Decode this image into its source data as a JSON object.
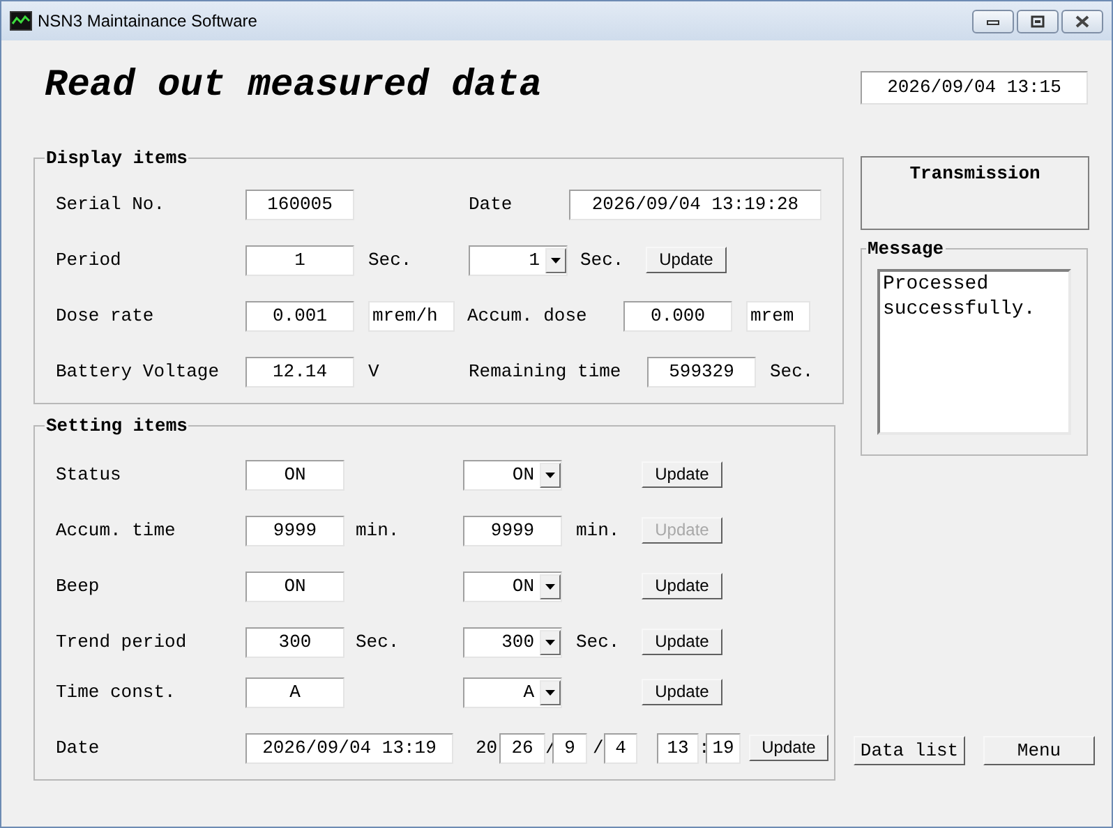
{
  "window": {
    "title": "NSN3 Maintainance Software"
  },
  "heading": "Read out measured data",
  "clock": "2026/09/04 13:15",
  "display_items": {
    "title": "Display items",
    "serial_no": {
      "label": "Serial No.",
      "value": "160005"
    },
    "date": {
      "label": "Date",
      "value": "2026/09/04 13:19:28"
    },
    "period": {
      "label": "Period",
      "value": "1",
      "unit": "Sec.",
      "select": "1",
      "select_unit": "Sec.",
      "button": "Update"
    },
    "dose_rate": {
      "label": "Dose rate",
      "value": "0.001",
      "unit": "mrem/h"
    },
    "accum_dose": {
      "label": "Accum. dose",
      "value": "0.000",
      "unit": "mrem"
    },
    "battery_voltage": {
      "label": "Battery Voltage",
      "value": "12.14",
      "unit": "V"
    },
    "remaining_time": {
      "label": "Remaining time",
      "value": "599329",
      "unit": "Sec."
    }
  },
  "setting_items": {
    "title": "Setting items",
    "rows": [
      {
        "label": "Status",
        "current": "ON",
        "kind": "dropdown",
        "new_value": "ON",
        "button": {
          "label": "Update",
          "disabled": false
        }
      },
      {
        "label": "Accum. time",
        "current": "9999",
        "unit": "min.",
        "kind": "field",
        "new_value": "9999",
        "new_unit": "min.",
        "button": {
          "label": "Update",
          "disabled": true
        }
      },
      {
        "label": "Beep",
        "current": "ON",
        "kind": "dropdown",
        "new_value": "ON",
        "button": {
          "label": "Update",
          "disabled": false
        }
      },
      {
        "label": "Trend period",
        "current": "300",
        "unit": "Sec.",
        "kind": "dropdown",
        "new_value": "300",
        "new_unit": "Sec.",
        "button": {
          "label": "Update",
          "disabled": false
        }
      },
      {
        "label": "Time const.",
        "current": "A",
        "kind": "dropdown",
        "new_value": "A",
        "button": {
          "label": "Update",
          "disabled": false
        }
      }
    ],
    "date": {
      "label": "Date",
      "current": "2026/09/04 13:19",
      "century": "20",
      "year": "26",
      "sep1": "/",
      "month": "9",
      "sep2": "/",
      "day": "4",
      "hour": "13",
      "colon": ":",
      "minute": "19",
      "button": {
        "label": "Update",
        "disabled": false
      }
    }
  },
  "transmission": {
    "title": "Transmission"
  },
  "message": {
    "title": "Message",
    "text": "Processed successfully."
  },
  "buttons": [
    "Data list",
    "Menu"
  ]
}
